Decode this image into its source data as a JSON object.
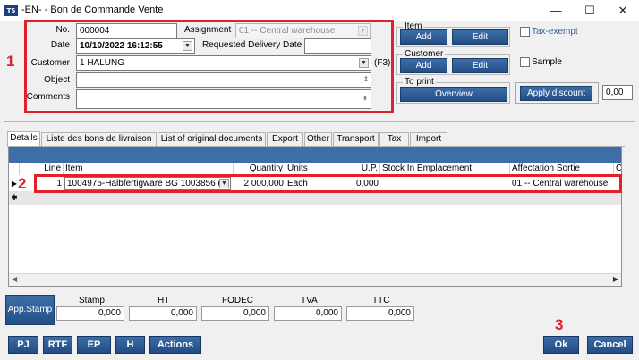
{
  "window": {
    "title": "-EN- - Bon de Commande Vente",
    "app_icon": "TS",
    "minimize": "—",
    "maximize": "☐",
    "close": "✕"
  },
  "header": {
    "no_label": "No.",
    "no_value": "000004",
    "assignment_label": "Assignment",
    "assignment_value": "01 -- Central warehouse",
    "date_label": "Date",
    "date_value": "10/10/2022 16:12:55",
    "requested_label": "Requested Delivery Date",
    "requested_value": "",
    "customer_label": "Customer",
    "customer_value": "1 HALUNG",
    "customer_hint": "(F3)",
    "object_label": "Object",
    "object_value": "",
    "comments_label": "Comments",
    "comments_value": ""
  },
  "side": {
    "item_group": "Item",
    "item_add": "Add",
    "item_edit": "Edit",
    "customer_group": "Customer",
    "customer_add": "Add",
    "customer_edit": "Edit",
    "print_group": "To print",
    "overview": "Overview",
    "tax_exempt": "Tax-exempt",
    "sample": "Sample",
    "apply_discount": "Apply discount",
    "discount_value": "0,00"
  },
  "tabs": [
    "Details",
    "Liste des bons de livraison",
    "List of original documents",
    "Export",
    "Other",
    "Transport",
    "Tax",
    "Import"
  ],
  "grid": {
    "columns": [
      "Line",
      "Item",
      "Quantity",
      "Units",
      "U.P.",
      "Stock In Emplacement",
      "Affectation Sortie",
      "C"
    ],
    "rows": [
      {
        "line": "1",
        "item": "1004975-Halbfertigware BG 1003856 (",
        "quantity": "2 000,000",
        "units": "Each",
        "up": "0,000",
        "stock": "",
        "affectation": "01 -- Central warehouse"
      }
    ],
    "new_row_marker": "✱",
    "current_row_marker": "▶"
  },
  "totals": {
    "app_stamp": "App.Stamp",
    "stamp_label": "Stamp",
    "stamp_value": "0,000",
    "ht_label": "HT",
    "ht_value": "0,000",
    "fodec_label": "FODEC",
    "fodec_value": "0,000",
    "tva_label": "TVA",
    "tva_value": "0,000",
    "ttc_label": "TTC",
    "ttc_value": "0,000"
  },
  "bottom": {
    "pj": "PJ",
    "rtf": "RTF",
    "ep": "EP",
    "h": "H",
    "actions": "Actions",
    "ok": "Ok",
    "cancel": "Cancel"
  },
  "markers": {
    "m1": "1",
    "m2": "2",
    "m3": "3"
  },
  "colors": {
    "accent_blue": "#2f5f99",
    "annotation_red": "#e0202c",
    "window_bg": "#f0f0f0"
  }
}
